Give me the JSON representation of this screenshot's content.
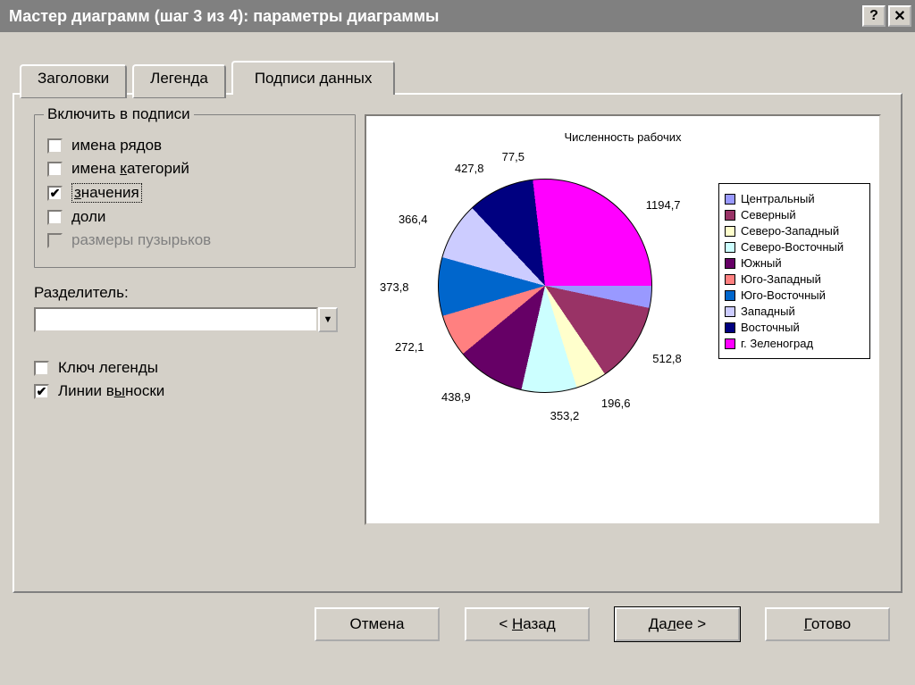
{
  "title": "Мастер диаграмм (шаг 3 из 4): параметры диаграммы",
  "tabs": {
    "headers_label": "Заголовки",
    "legend_label": "Легенда",
    "datalabels_label": "Подписи данных"
  },
  "groupbox": {
    "title": "Включить в подписи",
    "series_name": "имена рядов",
    "cat_name_pre": "имена ",
    "cat_name_u": "к",
    "cat_name_post": "атегорий",
    "values_u": "з",
    "values_post": "начения",
    "percent_u": "д",
    "percent_post": "оли",
    "bubble": "размеры пузырьков"
  },
  "separator": {
    "label_pre": "Раз",
    "label_u": "д",
    "label_post": "елитель:",
    "value": ""
  },
  "misc": {
    "legendkey": "Ключ легенды",
    "leaderlines_pre": "Линии в",
    "leaderlines_u": "ы",
    "leaderlines_post": "носки"
  },
  "buttons": {
    "cancel": "Отмена",
    "back_pre": "< ",
    "back_u": "Н",
    "back_post": "азад",
    "next_pre": "Да",
    "next_u": "л",
    "next_post": "ее >",
    "finish_u": "Г",
    "finish_post": "отово"
  },
  "chart": {
    "title": "Численность рабочих"
  },
  "chart_data": {
    "type": "pie",
    "title": "Численность рабочих",
    "series": [
      {
        "name": "Центральный",
        "value": 1194.7,
        "color": "#9999ff"
      },
      {
        "name": "Северный",
        "value": 512.8,
        "color": "#993366"
      },
      {
        "name": "Северо-Западный",
        "value": 196.6,
        "color": "#ffffcc"
      },
      {
        "name": "Северо-Восточный",
        "value": 353.2,
        "color": "#ccffff"
      },
      {
        "name": "Южный",
        "value": 438.9,
        "color": "#660066"
      },
      {
        "name": "Юго-Западный",
        "value": 272.1,
        "color": "#ff8080"
      },
      {
        "name": "Юго-Восточный",
        "value": 373.8,
        "color": "#0066cc"
      },
      {
        "name": "Западный",
        "value": 366.4,
        "color": "#ccccff"
      },
      {
        "name": "Восточный",
        "value": 427.8,
        "color": "#000080"
      },
      {
        "name": "г. Зеленоград",
        "value": 77.5,
        "color": "#ff00ff"
      }
    ],
    "labels": [
      "1194,7",
      "512,8",
      "196,6",
      "353,2",
      "438,9",
      "272,1",
      "373,8",
      "366,4",
      "427,8",
      "77,5"
    ]
  }
}
